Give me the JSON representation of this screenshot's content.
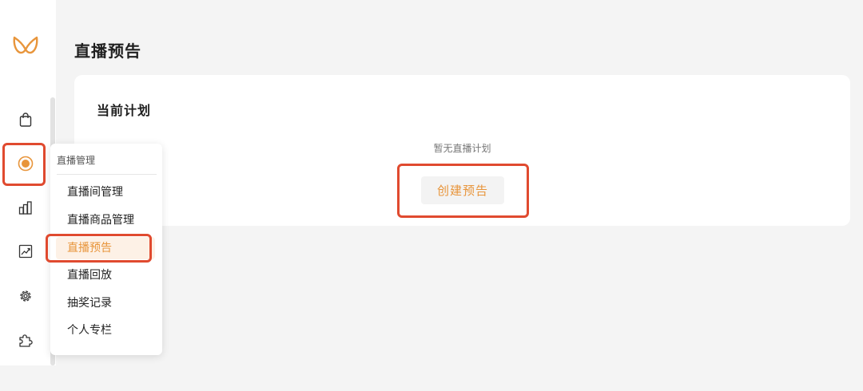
{
  "colors": {
    "accent": "#e8953b",
    "highlight_box": "#e04a2f",
    "page_background": "#f4f4f4",
    "card_background": "#ffffff"
  },
  "rail": {
    "logo": "brand-logo",
    "icons": [
      {
        "name": "shopping-bag-icon"
      },
      {
        "name": "live-record-icon",
        "active": true
      },
      {
        "name": "bar-chart-icon"
      },
      {
        "name": "trend-chart-icon"
      },
      {
        "name": "gear-icon"
      },
      {
        "name": "puzzle-icon"
      }
    ]
  },
  "page": {
    "title": "直播预告"
  },
  "card": {
    "title": "当前计划",
    "empty_text": "暂无直播计划",
    "create_button": "创建预告"
  },
  "menu": {
    "header": "直播管理",
    "items": [
      {
        "label": "直播间管理"
      },
      {
        "label": "直播商品管理"
      },
      {
        "label": "直播预告",
        "active": true
      },
      {
        "label": "直播回放"
      },
      {
        "label": "抽奖记录"
      },
      {
        "label": "个人专栏"
      }
    ]
  }
}
